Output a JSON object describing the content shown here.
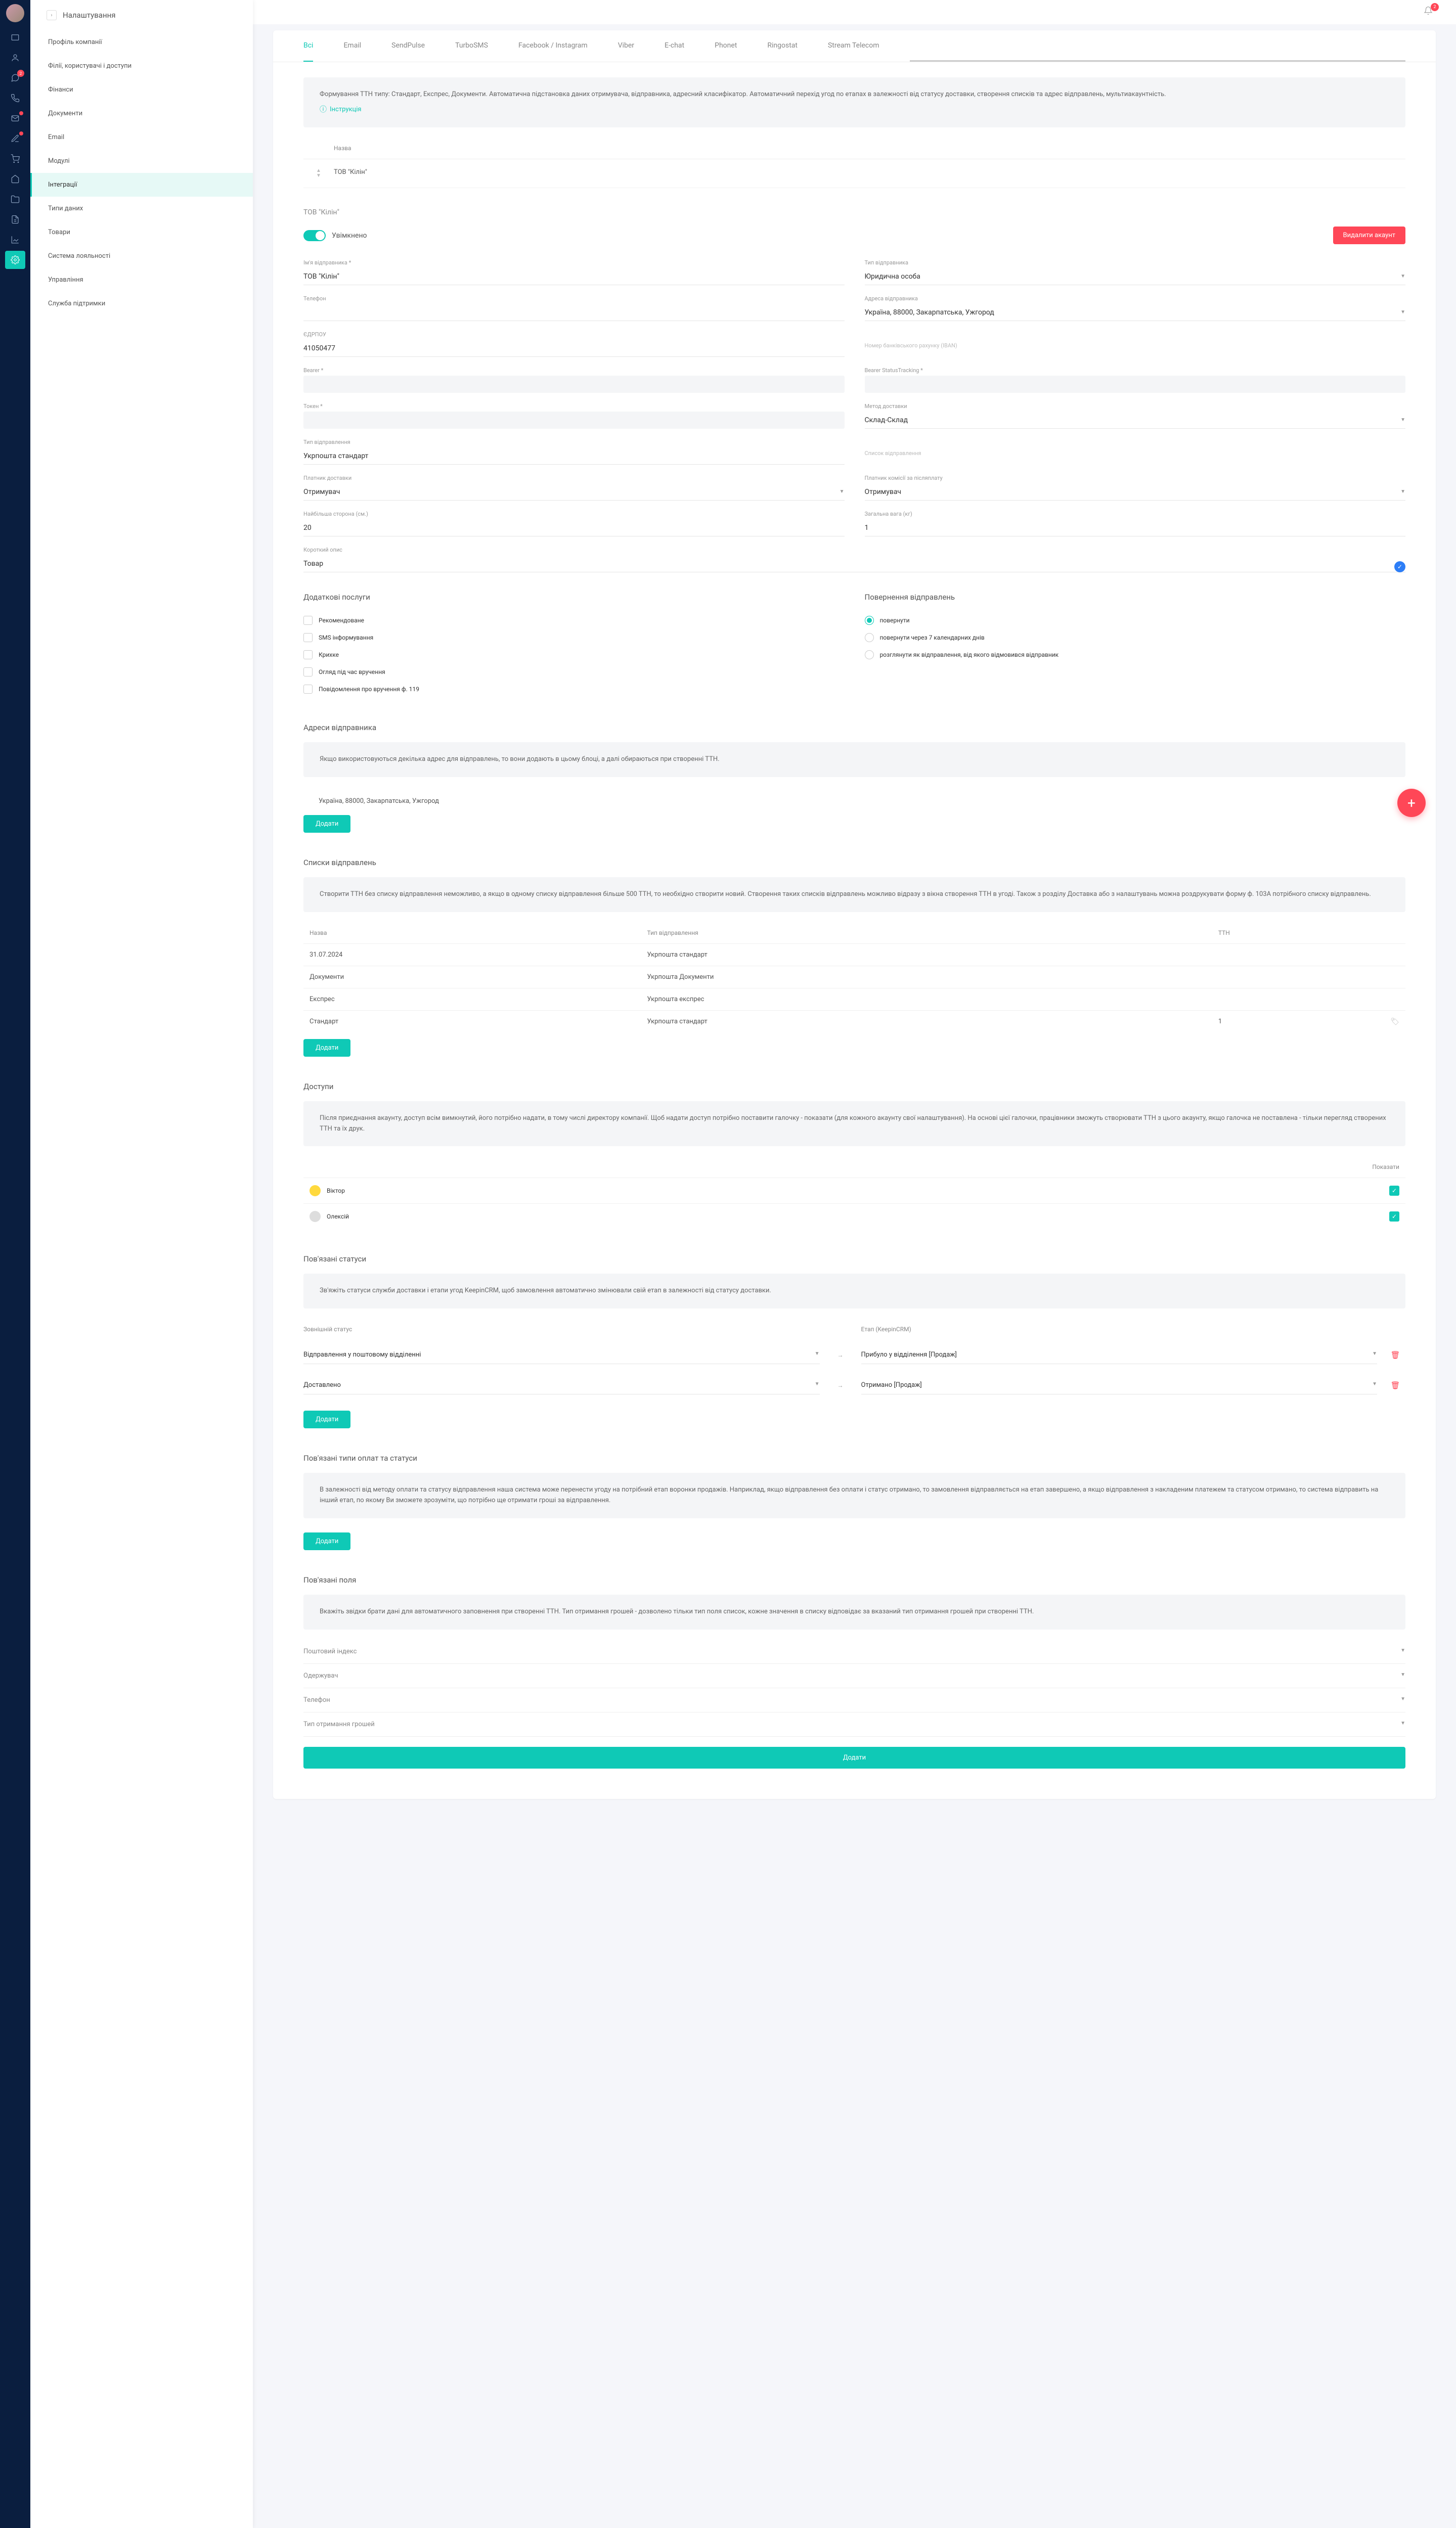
{
  "page_title": "Налаштування",
  "notification_count": "2",
  "rail_badges": {
    "chat": "2"
  },
  "sidebar": {
    "items": [
      "Профіль компанії",
      "Філії, користувачі і доступи",
      "Фінанси",
      "Документи",
      "Email",
      "Модулі",
      "Інтеграції",
      "Типи даних",
      "Товари",
      "Система лояльності",
      "Управління",
      "Служба підтримки"
    ],
    "active_index": 6
  },
  "tabs": [
    "Всі",
    "Email",
    "SendPulse",
    "TurboSMS",
    "Facebook / Instagram",
    "Viber",
    "E-chat",
    "Phonet",
    "Ringostat",
    "Stream Telecom"
  ],
  "active_tab": 0,
  "intro": {
    "text": "Формування ТТН типу: Стандарт, Експрес, Документи. Автоматична підстановка даних отримувача, відправника, адресний класифікатор. Автоматичний перехід угод по етапах в залежності від статусу доставки, створення списків та адрес відправлень, мультиакаунтність.",
    "link": "Інструкція"
  },
  "company_list": {
    "head_name": "Назва",
    "row_name": "ТОВ \"Кілін\""
  },
  "account": {
    "header": "ТОВ \"Кілін\"",
    "enabled_label": "Увімкнено",
    "delete_btn": "Видалити акаунт",
    "fields": {
      "sender_name_l": "Ім'я відправника *",
      "sender_name_v": "ТОВ \"Кілін\"",
      "sender_type_l": "Тип відправника",
      "sender_type_v": "Юридична особа",
      "phone_l": "Телефон",
      "phone_v": "",
      "sender_addr_l": "Адреса відправника",
      "sender_addr_v": "Україна, 88000, Закарпатська, Ужгород",
      "edrpou_l": "ЄДРПОУ",
      "edrpou_v": "41050477",
      "iban_l": "Номер банківського рахунку (IBAN)",
      "iban_v": "",
      "bearer_l": "Bearer *",
      "bearer_v": "",
      "bearer_st_l": "Bearer StatusTracking *",
      "bearer_st_v": "",
      "token_l": "Токен *",
      "token_v": "",
      "delivery_m_l": "Метод доставки",
      "delivery_m_v": "Склад-Склад",
      "send_type_l": "Тип відправлення",
      "send_type_v": "Укрпошта стандарт",
      "send_list_l": "Список відправлення",
      "send_list_v": "",
      "payer_l": "Платник доставки",
      "payer_v": "Отримувач",
      "cod_payer_l": "Платник комісії за післяплату",
      "cod_payer_v": "Отримувач",
      "max_side_l": "Найбільша сторона (см.)",
      "max_side_v": "20",
      "weight_l": "Загальна вага (кг)",
      "weight_v": "1",
      "desc_l": "Короткий опис",
      "desc_v": "Товар"
    }
  },
  "extras": {
    "title": "Додаткові послуги",
    "items": [
      "Рекомендоване",
      "SMS інформування",
      "Крихке",
      "Огляд під час вручення",
      "Повідомлення про вручення ф. 119"
    ]
  },
  "returns": {
    "title": "Повернення відправлень",
    "items": [
      "повернути",
      "повернути через 7 календарних днів",
      "розглянути як відправлення, від якого відмовився відправник"
    ],
    "checked": 0
  },
  "addresses": {
    "title": "Адреси відправника",
    "info": "Якщо використовуються декілька адрес для відправлень, то вони додають в цьому блоці, а далі обираються при створенні ТТН.",
    "rows": [
      "Україна, 88000, Закарпатська, Ужгород"
    ],
    "add_btn": "Додати"
  },
  "send_lists": {
    "title": "Списки відправлень",
    "info": "Створити ТТН без списку відправлення неможливо, а якщо в одному списку відправлення більше 500 ТТН, то необхідно створити новий. Створення таких списків відправлень можливо відразу з вікна створення ТТН в угоді. Також з розділу Доставка або з налаштувань можна роздрукувати форму ф. 103А потрібного списку відправлень.",
    "cols": [
      "Назва",
      "Тип відправлення",
      "ТТН"
    ],
    "rows": [
      {
        "name": "31.07.2024",
        "type": "Укрпошта стандарт",
        "ttn": ""
      },
      {
        "name": "Документи",
        "type": "Укрпошта Документи",
        "ttn": ""
      },
      {
        "name": "Експрес",
        "type": "Укрпошта експрес",
        "ttn": ""
      },
      {
        "name": "Стандарт",
        "type": "Укрпошта стандарт",
        "ttn": "1"
      }
    ],
    "add_btn": "Додати"
  },
  "access": {
    "title": "Доступи",
    "info": "Після приєднання акаунту, доступ всім вимкнутий, його потрібно надати, в тому числі директору компанії. Щоб надати доступ потрібно поставити галочку - показати (для кожного акаунту свої налаштування). На основі цієї галочки, працівники зможуть створювати ТТН з цього акаунту, якщо галочка не поставлена - тільки перегляд створених ТТН та їх друк.",
    "col_show": "Показати",
    "users": [
      {
        "name": "Віктор",
        "color": "y",
        "on": true
      },
      {
        "name": "Олексій",
        "color": "g",
        "on": true
      }
    ]
  },
  "statuses": {
    "title": "Пов'язані статуси",
    "info": "Зв'яжіть статуси служби доставки і етапи угод KeepinCRM, щоб замовлення автоматично змінювали свій етап в залежності від статусу доставки.",
    "col_ext": "Зовнішній статус",
    "col_stage": "Етап (KeepinCRM)",
    "rows": [
      {
        "ext": "Відправлення у поштовому відділенні",
        "stage": "Прибуло у відділення [Продаж]"
      },
      {
        "ext": "Доставлено",
        "stage": "Отримано [Продаж]"
      }
    ],
    "add_btn": "Додати"
  },
  "pay_types": {
    "title": "Пов'язані типи оплат та статуси",
    "info": "В залежності від методу оплати та статусу відправлення наша система може перенести угоду на потрібний етап воронки продажів. Наприклад, якщо відправлення без оплати і статус отримано, то замовлення відправляється на етап завершено, а якщо відправлення з накладеним платежем та статусом отримано, то система відправить на інший етап, по якому Ви зможете зрозуміти, що потрібно ще отримати гроші за відправлення.",
    "add_btn": "Додати"
  },
  "fields_sec": {
    "title": "Пов'язані поля",
    "info": "Вкажіть звідки брати дані для автоматичного заповнення при створенні ТТН. Тип отримання грошей - дозволено тільки тип поля список, кожне значення в списку відповідає за вказаний тип отримання грошей при створенні ТТН.",
    "rows": [
      "Поштовий індекс",
      "Одержувач",
      "Телефон",
      "Тип отримання грошей"
    ],
    "add_btn": "Додати"
  }
}
